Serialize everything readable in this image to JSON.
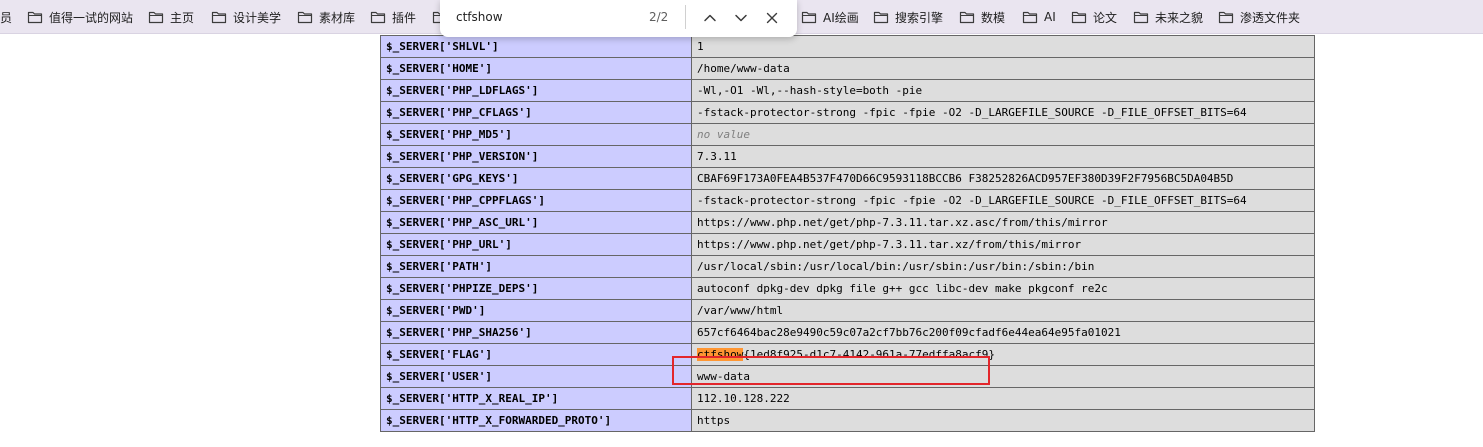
{
  "colors": {
    "bookmark_bar_bg": "#eae5f0",
    "key_cell_bg": "#ccccff",
    "value_cell_bg": "#dddddd",
    "search_highlight": "#ff9632",
    "annotation_border": "#e3262b"
  },
  "bookmarks": [
    {
      "label": "员",
      "icon": "none"
    },
    {
      "label": "值得一试的网站",
      "icon": "folder-icon"
    },
    {
      "label": "主页",
      "icon": "folder-icon"
    },
    {
      "label": "设计美学",
      "icon": "folder-icon"
    },
    {
      "label": "素材库",
      "icon": "folder-icon"
    },
    {
      "label": "插件",
      "icon": "folder-icon"
    },
    {
      "label": "AI绘画",
      "icon": "folder-icon"
    },
    {
      "label": "搜索引擎",
      "icon": "folder-icon"
    },
    {
      "label": "数模",
      "icon": "folder-icon"
    },
    {
      "label": "AI",
      "icon": "folder-icon"
    },
    {
      "label": "论文",
      "icon": "folder-icon"
    },
    {
      "label": "未来之貌",
      "icon": "folder-icon"
    },
    {
      "label": "渗透文件夹",
      "icon": "folder-icon"
    }
  ],
  "find": {
    "query": "ctfshow",
    "count": "2/2",
    "icons": [
      "chevron-up-icon",
      "chevron-down-icon",
      "close-icon"
    ]
  },
  "rows": [
    {
      "key": "$_SERVER['SHLVL']",
      "value": "1"
    },
    {
      "key": "$_SERVER['HOME']",
      "value": "/home/www-data"
    },
    {
      "key": "$_SERVER['PHP_LDFLAGS']",
      "value": "-Wl,-O1 -Wl,--hash-style=both -pie"
    },
    {
      "key": "$_SERVER['PHP_CFLAGS']",
      "value": "-fstack-protector-strong -fpic -fpie -O2 -D_LARGEFILE_SOURCE -D_FILE_OFFSET_BITS=64"
    },
    {
      "key": "$_SERVER['PHP_MD5']",
      "value": "no value",
      "style": "novalue"
    },
    {
      "key": "$_SERVER['PHP_VERSION']",
      "value": "7.3.11"
    },
    {
      "key": "$_SERVER['GPG_KEYS']",
      "value": "CBAF69F173A0FEA4B537F470D66C9593118BCCB6 F38252826ACD957EF380D39F2F7956BC5DA04B5D"
    },
    {
      "key": "$_SERVER['PHP_CPPFLAGS']",
      "value": "-fstack-protector-strong -fpic -fpie -O2 -D_LARGEFILE_SOURCE -D_FILE_OFFSET_BITS=64"
    },
    {
      "key": "$_SERVER['PHP_ASC_URL']",
      "value": "https://www.php.net/get/php-7.3.11.tar.xz.asc/from/this/mirror"
    },
    {
      "key": "$_SERVER['PHP_URL']",
      "value": "https://www.php.net/get/php-7.3.11.tar.xz/from/this/mirror"
    },
    {
      "key": "$_SERVER['PATH']",
      "value": "/usr/local/sbin:/usr/local/bin:/usr/sbin:/usr/bin:/sbin:/bin"
    },
    {
      "key": "$_SERVER['PHPIZE_DEPS']",
      "value": "autoconf dpkg-dev dpkg file g++ gcc libc-dev make pkgconf re2c"
    },
    {
      "key": "$_SERVER['PWD']",
      "value": "/var/www/html"
    },
    {
      "key": "$_SERVER['PHP_SHA256']",
      "value": "657cf6464bac28e9490c59c07a2cf7bb76c200f09cfadf6e44ea64e95fa01021"
    },
    {
      "key": "$_SERVER['FLAG']",
      "value_highlight": "ctfshow",
      "value_rest": "{1ed8f925-d1c7-4142-961a-77edffa8acf9}",
      "style": "flag"
    },
    {
      "key": "$_SERVER['USER']",
      "value": "www-data"
    },
    {
      "key": "$_SERVER['HTTP_X_REAL_IP']",
      "value": "112.10.128.222"
    },
    {
      "key": "$_SERVER['HTTP_X_FORWARDED_PROTO']",
      "value": "https"
    }
  ]
}
